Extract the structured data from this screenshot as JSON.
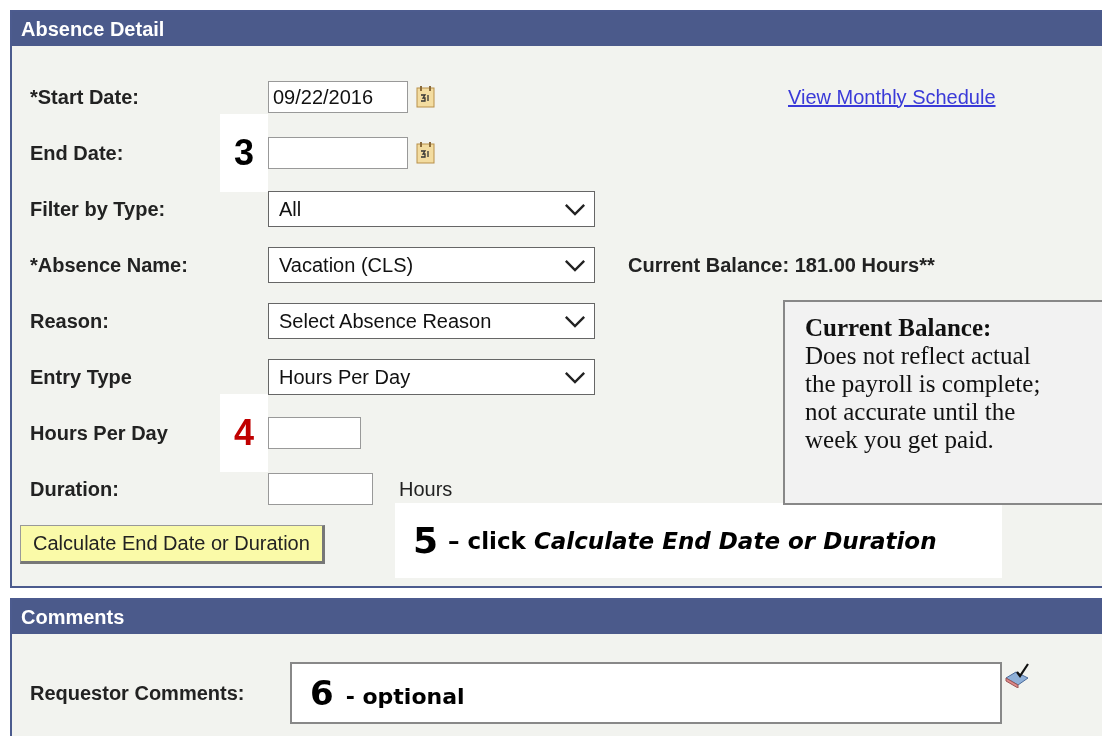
{
  "absence_detail": {
    "title": "Absence Detail",
    "rows": [
      {
        "kind": "date",
        "label": "*Start Date:",
        "value": "09/22/2016",
        "link": "View Monthly Schedule"
      },
      {
        "kind": "date",
        "label": "End Date:",
        "value": "",
        "annotation": {
          "number": "3",
          "color": "#000000"
        }
      },
      {
        "kind": "select",
        "label": "Filter by Type:",
        "value": "All"
      },
      {
        "kind": "select",
        "label": "*Absence Name:",
        "value": "Vacation (CLS)",
        "note": "Current Balance: 181.00 Hours**"
      },
      {
        "kind": "select",
        "label": "Reason:",
        "value": "Select Absence Reason"
      },
      {
        "kind": "select",
        "label": "Entry Type",
        "value": "Hours Per Day"
      },
      {
        "kind": "short",
        "label": "Hours Per Day",
        "value": "",
        "annotation": {
          "number": "4",
          "color": "#c00000"
        }
      },
      {
        "kind": "medium",
        "label": "Duration:",
        "value": "",
        "unit": "Hours"
      }
    ],
    "button": "Calculate End Date or Duration",
    "button_annotation": {
      "number": "5",
      "text": "– click *Calculate End Date or Duration*"
    },
    "tooltip": {
      "title": "Current Balance:",
      "lines": [
        "Does not reflect actual",
        "the payroll is complete;",
        "not accurate until the",
        "week you get paid."
      ]
    }
  },
  "comments": {
    "title": "Comments",
    "label": "Requestor Comments:",
    "annotation": {
      "number": "6",
      "text": "- optional"
    }
  }
}
